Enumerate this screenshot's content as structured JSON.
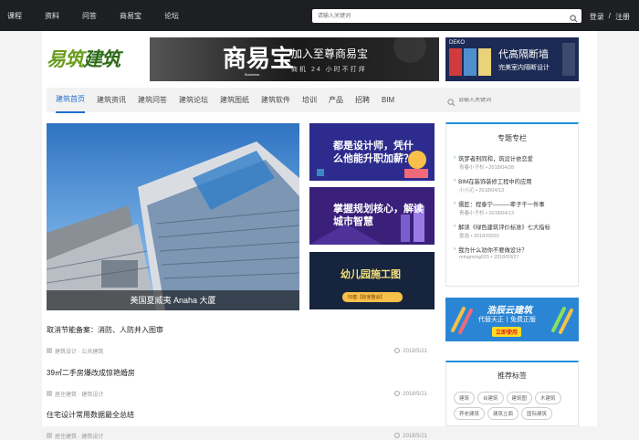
{
  "topbar": {
    "nav": [
      "课程",
      "资料",
      "问答",
      "商易宝",
      "论坛"
    ],
    "search_placeholder": "请输入关键词",
    "login": "登录",
    "divider": "/",
    "register": "注册"
  },
  "logo": {
    "text1": "易筑",
    "text2": "建筑"
  },
  "banner_ad": {
    "brand": "商易宝",
    "brand_sub": "Business",
    "headline": "加入至尊商易宝",
    "subline": "商机 24 小时不打烊"
  },
  "banner_deko": {
    "logo": "DEKO",
    "headline": "代高隔断墙",
    "subline": "完美室内隔断设计"
  },
  "mainnav": {
    "items": [
      "建筑首页",
      "建筑资讯",
      "建筑问答",
      "建筑论坛",
      "建筑图纸",
      "建筑软件",
      "培训",
      "产品",
      "招聘",
      "BIM"
    ],
    "search_placeholder": "请输入关键词"
  },
  "hero": {
    "caption": "美国夏威夷 Anaha 大厦"
  },
  "side_banners": [
    {
      "text": "都是设计师，凭什么他能升职加薪？"
    },
    {
      "text": "掌握规划核心，解读城市智慧"
    },
    {
      "text": "幼儿园施工图",
      "badge": "50套【抢家整会】"
    }
  ],
  "news": [
    {
      "title": "取消节能备案：消防、人防并入图审",
      "tags": "建筑设计 · 公共建筑",
      "date": "2018/5/21"
    },
    {
      "title": "39㎡二手房爆改成惊艳婚房",
      "tags": "居住建筑 · 建筑设计",
      "date": "2018/5/21"
    },
    {
      "title": "住宅设计常用数据最全总结",
      "tags": "居住建筑 · 建筑设计",
      "date": "2018/5/21"
    }
  ],
  "columns": {
    "title": "专题专栏",
    "items": [
      {
        "title": "筑梦者刑同和，筑设计依恋爱",
        "meta": "青春小子杉 • 2018/04/28"
      },
      {
        "title": "BIM在装饰装修工程中的应用",
        "meta": "小小沁 • 2018/04/13"
      },
      {
        "title": "儒匠：程泰宁———辈子干一件事",
        "meta": "青春小子杉 • 2018/04/13"
      },
      {
        "title": "解读《绿色建筑评价标准》七大指标",
        "meta": "墨选 • 2018/03/20"
      },
      {
        "title": "我为什么劝你不要做设计？",
        "meta": "mingming025 • 2018/03/27"
      }
    ]
  },
  "ad": {
    "title": "浩辰云建筑",
    "sub": "代替天正丨免费正版",
    "cta": "立即使用"
  },
  "tags": {
    "title": "推荐标签",
    "items": [
      "建筑",
      "台建筑",
      "建筑图",
      "木建筑",
      "养老建筑",
      "建筑立面",
      "国际建筑"
    ]
  },
  "colors": {
    "accent": "#1f6fd1",
    "panel_border": "#1f8fd8",
    "topbar_bg": "#1d1f23"
  }
}
